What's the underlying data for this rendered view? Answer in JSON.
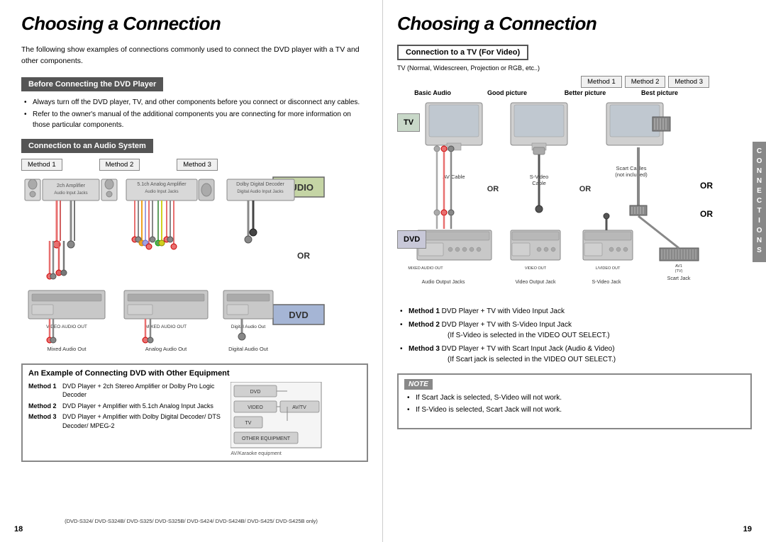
{
  "left_page": {
    "title": "Choosing a Connection",
    "intro": "The following show examples of connections commonly used to connect the DVD player with a TV and other components.",
    "section1": {
      "header": "Before Connecting the DVD Player",
      "bullets": [
        "Always turn off the DVD player, TV, and other components before you connect or disconnect any cables.",
        "Refer to the owner's manual of the additional components you are connecting for more information on those particular components."
      ]
    },
    "section2": {
      "header": "Connection to an Audio System",
      "methods": [
        "Method 1",
        "Method 2",
        "Method 3"
      ],
      "col1": {
        "device_label": "2ch Amplifier\nAudio Input Jacks",
        "out_label": "Mixed Audio Out"
      },
      "col2": {
        "device_label": "5.1ch Analog Amplifier\nAudio Input Jacks",
        "out_label": "Analog Audio Out"
      },
      "col3": {
        "device_label": "Dolby Digital Decoder\nDigital Audio Input Jacks",
        "out_label": "Digital Audio Out"
      },
      "audio_label": "AUDIO",
      "or_label": "OR",
      "dvd_label": "DVD"
    },
    "section3": {
      "header": "An Example of Connecting DVD with Other Equipment",
      "methods": [
        {
          "num": "Method 1",
          "text": "DVD Player + 2ch Stereo Amplifier or Dolby Pro Logic Decoder"
        },
        {
          "num": "Method 2",
          "text": "DVD Player + Amplifier with 5.1ch Analog Input Jacks"
        },
        {
          "num": "Method 3",
          "text": "DVD Player + Amplifier with Dolby Digital Decoder/ DTS Decoder/ MPEG-2"
        }
      ],
      "diagram_items": [
        "DVD",
        "VIDEO",
        "TV",
        "AV/TV",
        "OTHER EQUIPMENT",
        "AV/Karaoke equipment"
      ]
    },
    "page_number": "18",
    "copyright": "(DVD-S324/ DVD-S324B/ DVD-S325/ DVD-S325B/\nDVD-S424/ DVD-S424B/ DVD-S425/ DVD-S425B only)"
  },
  "right_page": {
    "title": "Choosing a Connection",
    "section1": {
      "header": "Connection to a TV (For Video)",
      "subtitle": "TV (Normal, Widescreen, Projection or RGB, etc..)",
      "methods": [
        "Method 1",
        "Method 2",
        "Method 3"
      ],
      "col_labels": [
        "Basic Audio",
        "Good picture",
        "Better picture",
        "Best picture"
      ],
      "tv_label": "TV",
      "dvd_label": "DVD",
      "or_label": "OR",
      "cable_labels": [
        "AV Cable",
        "S-Video\nCable",
        "Scart Cables\n(not included)"
      ],
      "jack_labels": [
        "Audio Output Jacks",
        "Video Output Jack",
        "S-Video Jack",
        "Scart Jack"
      ],
      "output_labels": [
        "MIXED AUDIO OUT",
        "VIDEO OUT",
        "L/VIDEO OUT"
      ]
    },
    "method_descriptions": [
      {
        "num": "Method 1",
        "text": "DVD Player + TV with Video Input Jack"
      },
      {
        "num": "Method 2",
        "text": "DVD Player + TV with S-Video Input Jack\n(If S-Video is selected in the VIDEO OUT SELECT.)"
      },
      {
        "num": "Method 3",
        "text": "DVD Player + TV with Scart Input Jack (Audio & Video)\n(If Scart jack is selected in the VIDEO OUT SELECT.)"
      }
    ],
    "note": {
      "header": "NOTE",
      "bullets": [
        "If Scart Jack is selected, S-Video will not work.",
        "If S-Video is selected, Scart Jack will not work."
      ]
    },
    "connections_tab": "CONNECTIONS",
    "page_number": "19"
  }
}
